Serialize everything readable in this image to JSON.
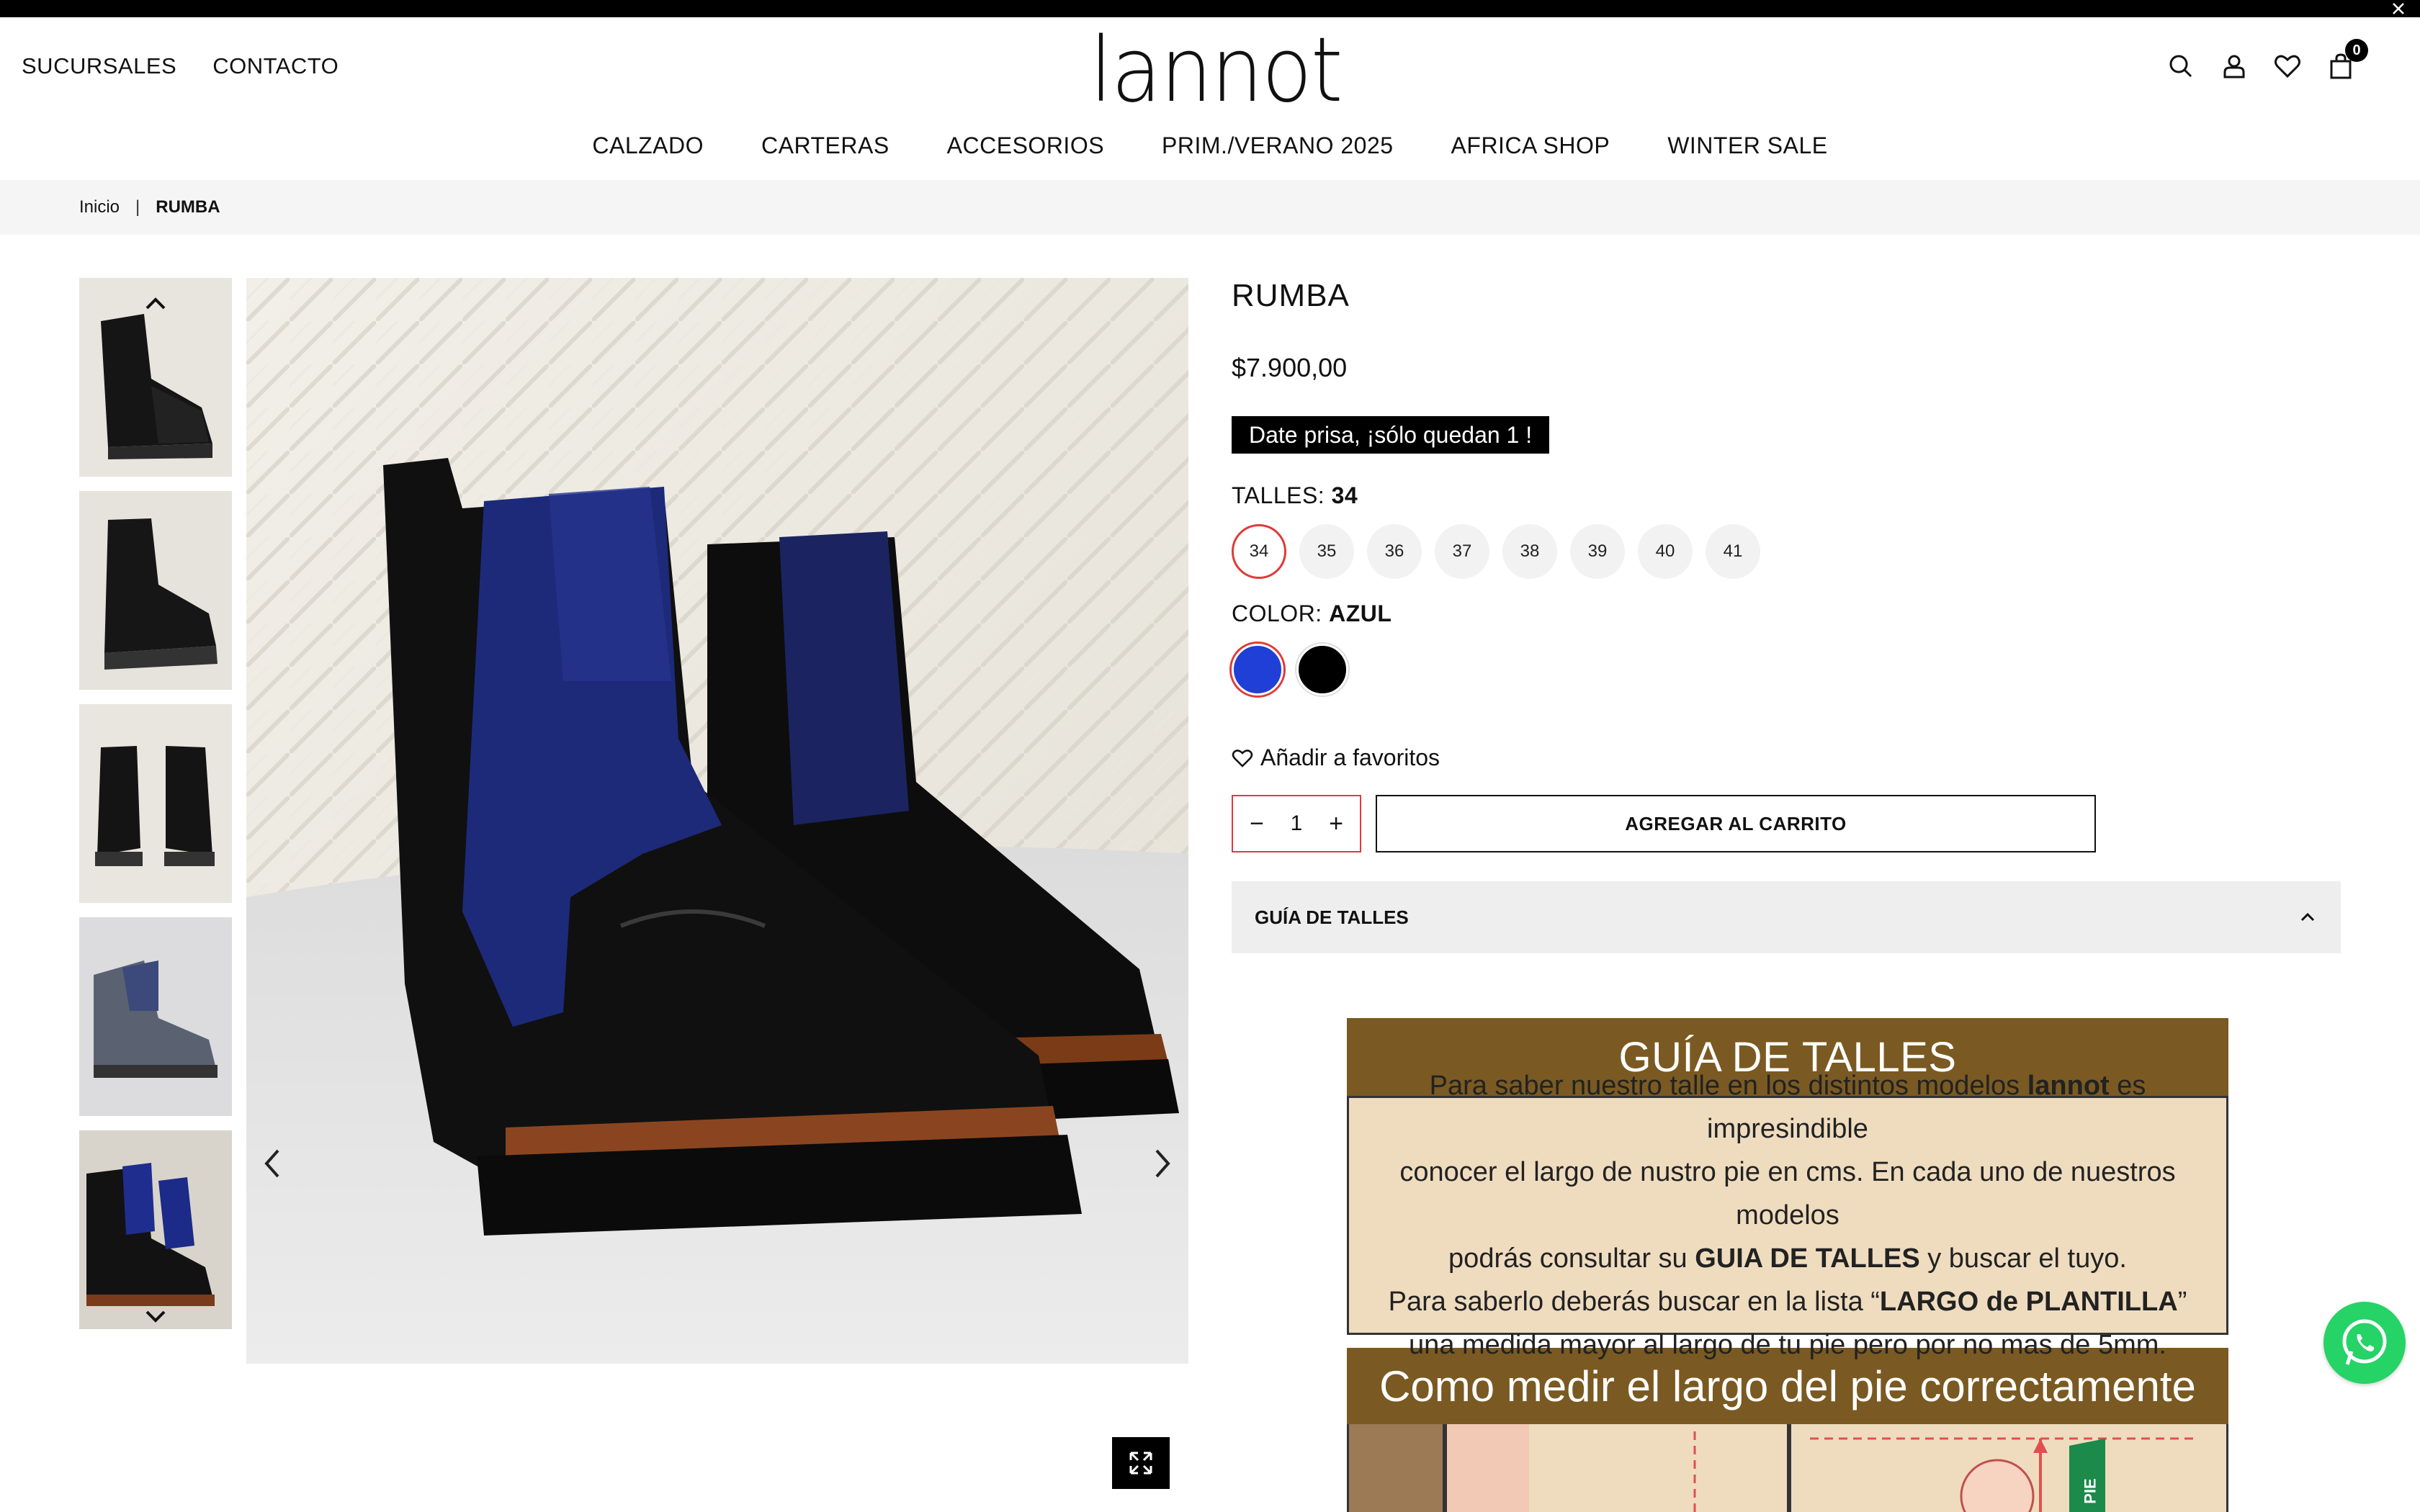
{
  "header": {
    "links": [
      "SUCURSALES",
      "CONTACTO"
    ],
    "logo_text": "lannot",
    "cart_count": "0",
    "icons": [
      "search-icon",
      "user-icon",
      "heart-icon",
      "bag-icon"
    ]
  },
  "nav": {
    "items": [
      "CALZADO",
      "CARTERAS",
      "ACCESORIOS",
      "PRIM./VERANO 2025",
      "AFRICA SHOP",
      "WINTER SALE"
    ]
  },
  "breadcrumb": {
    "home": "Inicio",
    "separator": "|",
    "current": "RUMBA"
  },
  "product": {
    "title": "RUMBA",
    "price": "$7.900,00",
    "stock_message": "Date prisa, ¡sólo quedan 1 !",
    "size_label": "TALLES:",
    "selected_size": "34",
    "sizes": [
      "34",
      "35",
      "36",
      "37",
      "38",
      "39",
      "40",
      "41"
    ],
    "color_label": "COLOR:",
    "selected_color": "AZUL",
    "colors": [
      {
        "name": "azul",
        "hex": "#1f3fd6"
      },
      {
        "name": "negro",
        "hex": "#000000"
      }
    ],
    "favorite_label": "Añadir a favoritos",
    "quantity": "1",
    "add_to_cart_label": "AGREGAR AL CARRITO",
    "size_guide_accordion": "GUÍA DE TALLES"
  },
  "size_guide": {
    "heading": "GUÍA DE TALLES",
    "line1_a": "Para saber nuestro talle en los distintos modelos ",
    "line1_b": "lannot",
    "line1_c": " es impresindible",
    "line2": "conocer el largo de nustro pie en cms. En cada uno de nuestros modelos",
    "line3_a": "podrás consultar su ",
    "line3_b": "GUIA DE TALLES",
    "line3_c": " y buscar el tuyo.",
    "line4_a": "Para saberlo deberás buscar en la lista “",
    "line4_b": "LARGO de PLANTILLA",
    "line4_c": "”",
    "line5": "una medida mayor al largo de tu pie pero por no mas de 5mm.",
    "heading2": "Como medir el largo del pie correctamente",
    "illus_text": "PIE"
  },
  "colors": {
    "accent": "#e03a3a",
    "guide_brown": "#7a5a22",
    "guide_beige": "#efdcbf",
    "whatsapp": "#25d366"
  }
}
